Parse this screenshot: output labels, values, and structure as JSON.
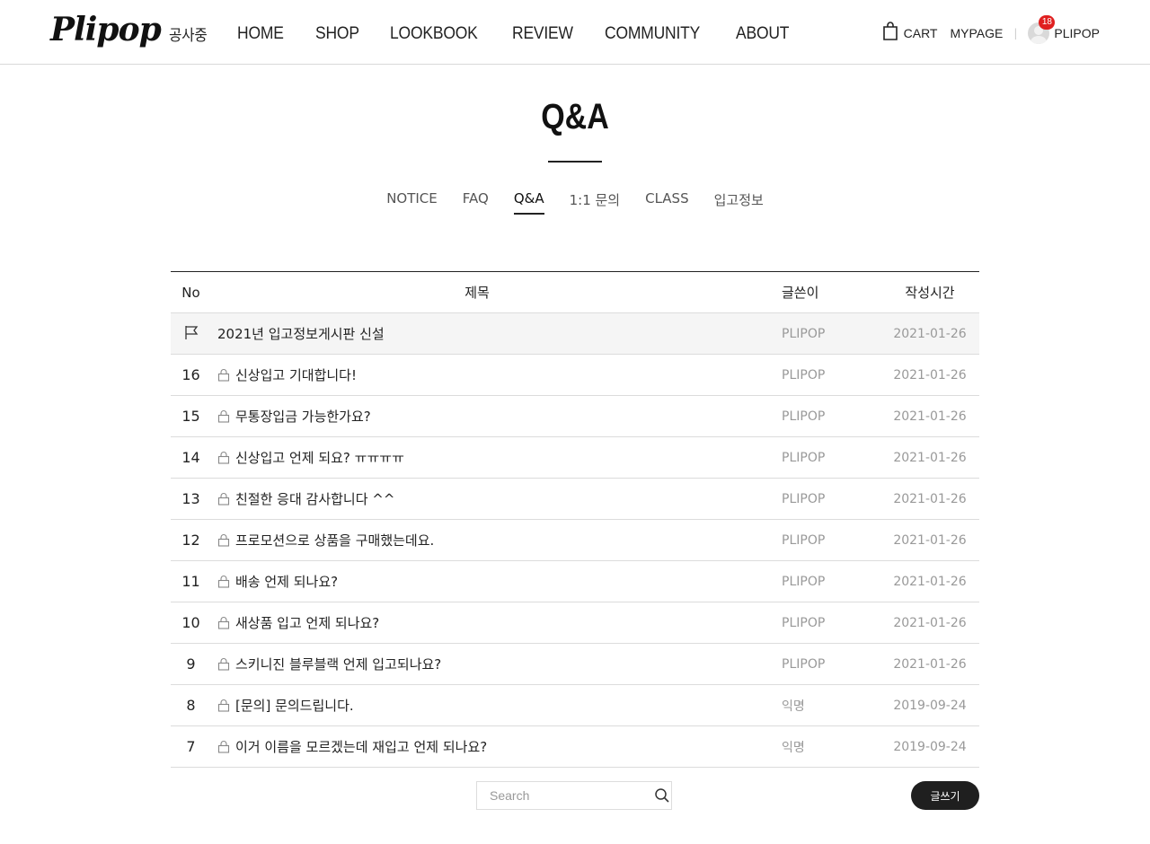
{
  "header": {
    "logo": "Plipop",
    "nav": [
      "공사중",
      "HOME",
      "SHOP",
      "LOOKBOOK",
      "REVIEW",
      "COMMUNITY",
      "ABOUT"
    ],
    "cart_label": "CART",
    "mypage_label": "MYPAGE",
    "separator": "|",
    "user_name": "PLIPOP",
    "notification_count": "18"
  },
  "page": {
    "title": "Q&A",
    "tabs": [
      "NOTICE",
      "FAQ",
      "Q&A",
      "1:1 문의",
      "CLASS",
      "입고정보"
    ],
    "active_tab": "Q&A"
  },
  "board": {
    "columns": {
      "no": "No",
      "title": "제목",
      "writer": "글쓴이",
      "date": "작성시간"
    },
    "notice": {
      "title": "2021년 입고정보게시판 신설",
      "writer": "PLIPOP",
      "date": "2021-01-26"
    },
    "rows": [
      {
        "no": "16",
        "title": "신상입고 기대합니다!",
        "writer": "PLIPOP",
        "date": "2021-01-26"
      },
      {
        "no": "15",
        "title": "무통장입금 가능한가요?",
        "writer": "PLIPOP",
        "date": "2021-01-26"
      },
      {
        "no": "14",
        "title": "신상입고 언제 되요? ㅠㅠㅠㅠ",
        "writer": "PLIPOP",
        "date": "2021-01-26"
      },
      {
        "no": "13",
        "title": "친절한 응대 감사합니다 ^^",
        "writer": "PLIPOP",
        "date": "2021-01-26"
      },
      {
        "no": "12",
        "title": "프로모션으로 상품을 구매했는데요.",
        "writer": "PLIPOP",
        "date": "2021-01-26"
      },
      {
        "no": "11",
        "title": "배송 언제 되나요?",
        "writer": "PLIPOP",
        "date": "2021-01-26"
      },
      {
        "no": "10",
        "title": "새상품 입고 언제 되나요?",
        "writer": "PLIPOP",
        "date": "2021-01-26"
      },
      {
        "no": "9",
        "title": "스키니진 블루블랙 언제 입고되나요?",
        "writer": "PLIPOP",
        "date": "2021-01-26"
      },
      {
        "no": "8",
        "title": "[문의] 문의드립니다.",
        "writer": "익명",
        "date": "2019-09-24"
      },
      {
        "no": "7",
        "title": "이거 이름을 모르겠는데 재입고 언제 되나요?",
        "writer": "익명",
        "date": "2019-09-24"
      }
    ]
  },
  "search": {
    "placeholder": "Search"
  },
  "write_button": "글쓰기"
}
